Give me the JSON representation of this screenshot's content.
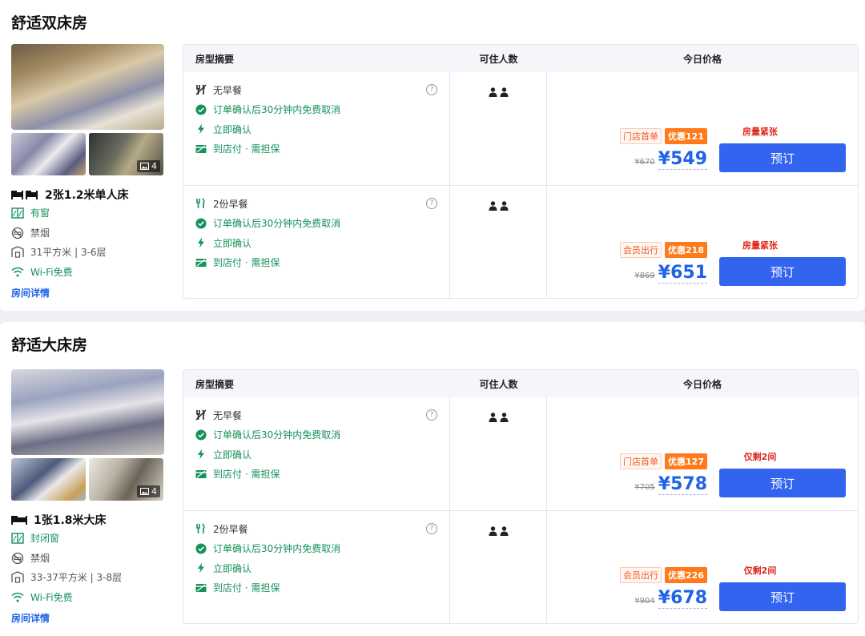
{
  "headers": {
    "summary": "房型摘要",
    "guests": "可住人数",
    "price": "今日价格"
  },
  "rooms": [
    {
      "title": "舒适双床房",
      "photo_count": "4",
      "bed": "2张1.2米单人床",
      "window": "有窗",
      "smoking": "禁烟",
      "area": "31平方米 | 3-6层",
      "wifi": "Wi-Fi免费",
      "detail_link": "房间详情",
      "plans": [
        {
          "meal": "无早餐",
          "cancel": "订单确认后30分钟内免费取消",
          "confirm": "立即确认",
          "payment": "到店付 · 需担保",
          "promo_tag": "门店首单",
          "discount": "优惠121",
          "old_price": "¥670",
          "price": "¥549",
          "stock": "房量紧张",
          "book": "预订"
        },
        {
          "meal": "2份早餐",
          "cancel": "订单确认后30分钟内免费取消",
          "confirm": "立即确认",
          "payment": "到店付 · 需担保",
          "promo_tag": "会员出行",
          "discount": "优惠218",
          "old_price": "¥869",
          "price": "¥651",
          "stock": "房量紧张",
          "book": "预订"
        }
      ]
    },
    {
      "title": "舒适大床房",
      "photo_count": "4",
      "bed": "1张1.8米大床",
      "window": "封闭窗",
      "smoking": "禁烟",
      "area": "33-37平方米 | 3-8层",
      "wifi": "Wi-Fi免费",
      "detail_link": "房间详情",
      "plans": [
        {
          "meal": "无早餐",
          "cancel": "订单确认后30分钟内免费取消",
          "confirm": "立即确认",
          "payment": "到店付 · 需担保",
          "promo_tag": "门店首单",
          "discount": "优惠127",
          "old_price": "¥705",
          "price": "¥578",
          "stock": "仅剩2间",
          "book": "预订"
        },
        {
          "meal": "2份早餐",
          "cancel": "订单确认后30分钟内免费取消",
          "confirm": "立即确认",
          "payment": "到店付 · 需担保",
          "promo_tag": "会员出行",
          "discount": "优惠226",
          "old_price": "¥904",
          "price": "¥678",
          "stock": "仅剩2间",
          "book": "预订"
        }
      ]
    }
  ],
  "colors": {
    "accent": "#3264f0",
    "price": "#1f63e6",
    "green": "#15915b",
    "stock": "#e0261c",
    "discount": "#ff7a1a"
  }
}
